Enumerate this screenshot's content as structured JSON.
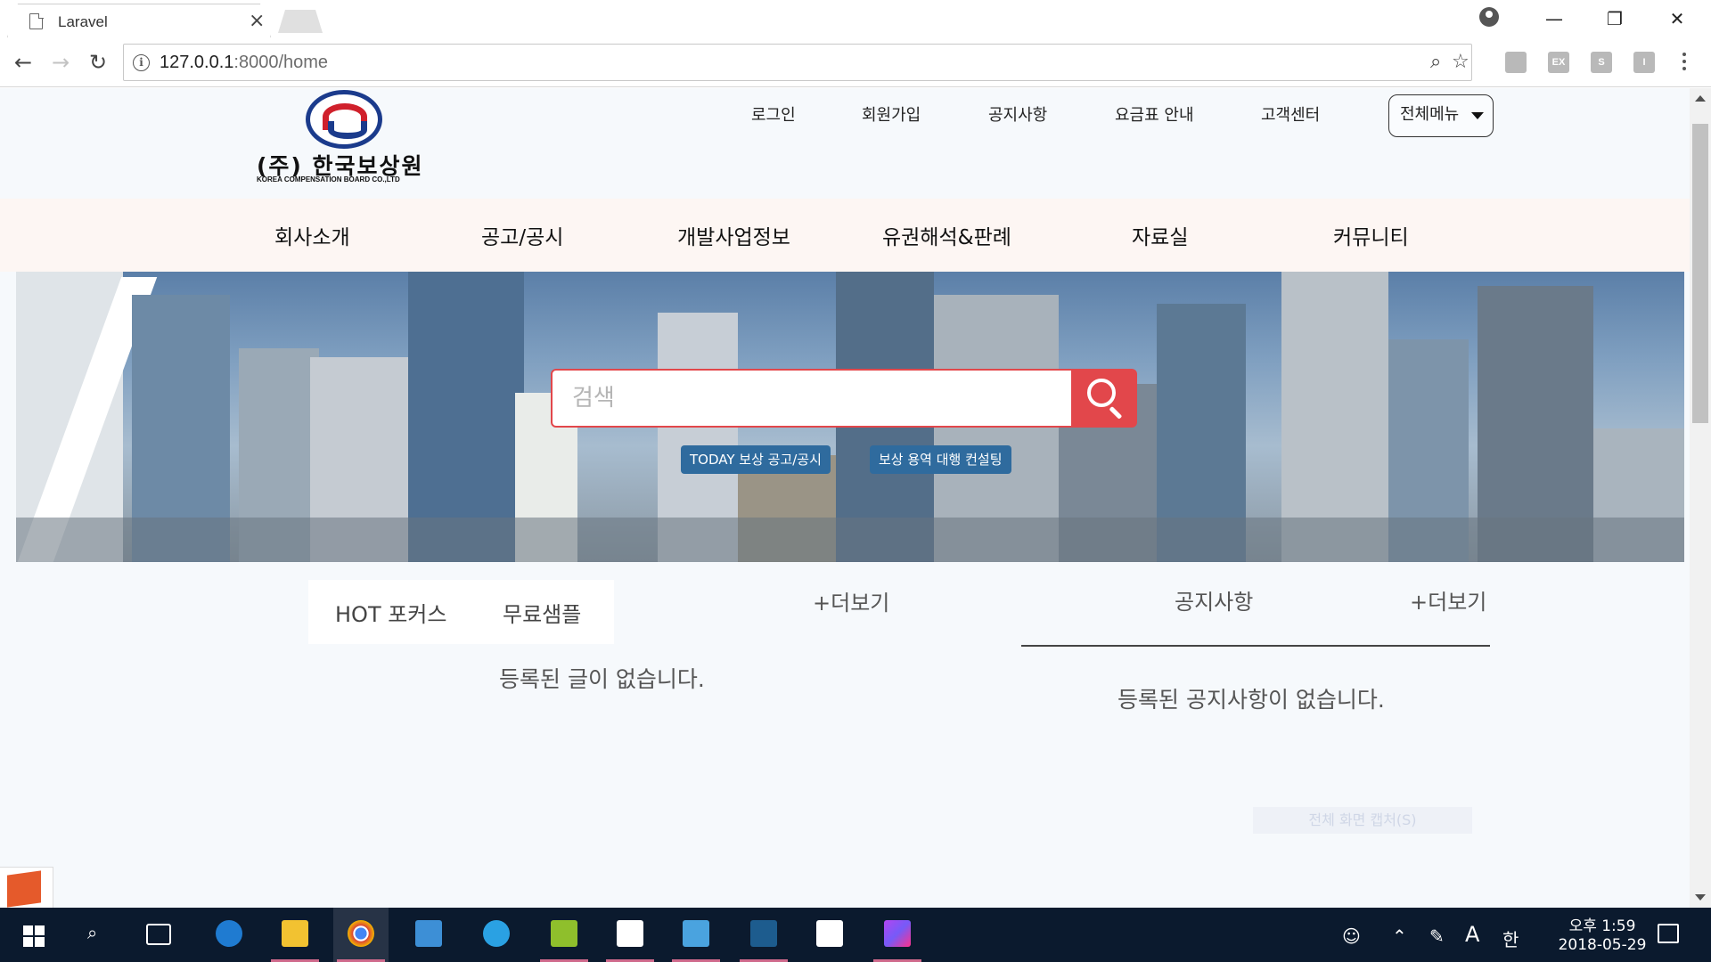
{
  "browser": {
    "tab_title": "Laravel",
    "tab_close": "×",
    "url_host": "127.0.0.1",
    "url_path": ":8000/home",
    "window_minimize": "—",
    "window_restore": "❐",
    "window_close": "✕",
    "extensions": [
      "Adobe Acrobat",
      "EX",
      "S",
      "I"
    ],
    "extension_labels": [
      "",
      "EX",
      "S",
      "I"
    ]
  },
  "header": {
    "logo_text": "(주) 한국보상원",
    "logo_subtext": "KOREA COMPENSATION BOARD CO.,LTD",
    "top_links": [
      "로그인",
      "회원가입",
      "공지사항",
      "요금표 안내",
      "고객센터"
    ],
    "all_menu_label": "전체메뉴"
  },
  "gnb": {
    "items": [
      "회사소개",
      "공고/공시",
      "개발사업정보",
      "유권해석&판례",
      "자료실",
      "커뮤니티"
    ]
  },
  "hero": {
    "search_placeholder": "검색",
    "tags": [
      "TODAY 보상 공고/공시",
      "보상 용역 대행 컨설팅"
    ]
  },
  "content": {
    "hot_tabs": [
      "HOT 포커스",
      "무료샘플"
    ],
    "hot_more": "+더보기",
    "hot_empty": "등록된 글이 없습니다.",
    "notice_title": "공지사항",
    "notice_more": "+더보기",
    "notice_empty": "등록된 공지사항이 없습니다.",
    "ghost_tooltip": "전체 화면 캡처(S)"
  },
  "taskbar": {
    "apps": [
      "Start",
      "Search",
      "Task View",
      "Edge",
      "File Explorer",
      "Chrome",
      "Control Panel",
      "Internet Explorer",
      "Lambda App",
      "Sticky Notes",
      "Database Tool",
      "MySQL Workbench",
      "Photos",
      "PhpStorm"
    ],
    "time": "오후 1:59",
    "date": "2018-05-29",
    "ime_label": "A",
    "ime_lang": "한"
  },
  "colors": {
    "accent_red": "#e2474b",
    "tag_blue": "#2f6b9e",
    "nav_bg": "#fdf6f3",
    "taskbar_bg": "#0b1a2e"
  }
}
